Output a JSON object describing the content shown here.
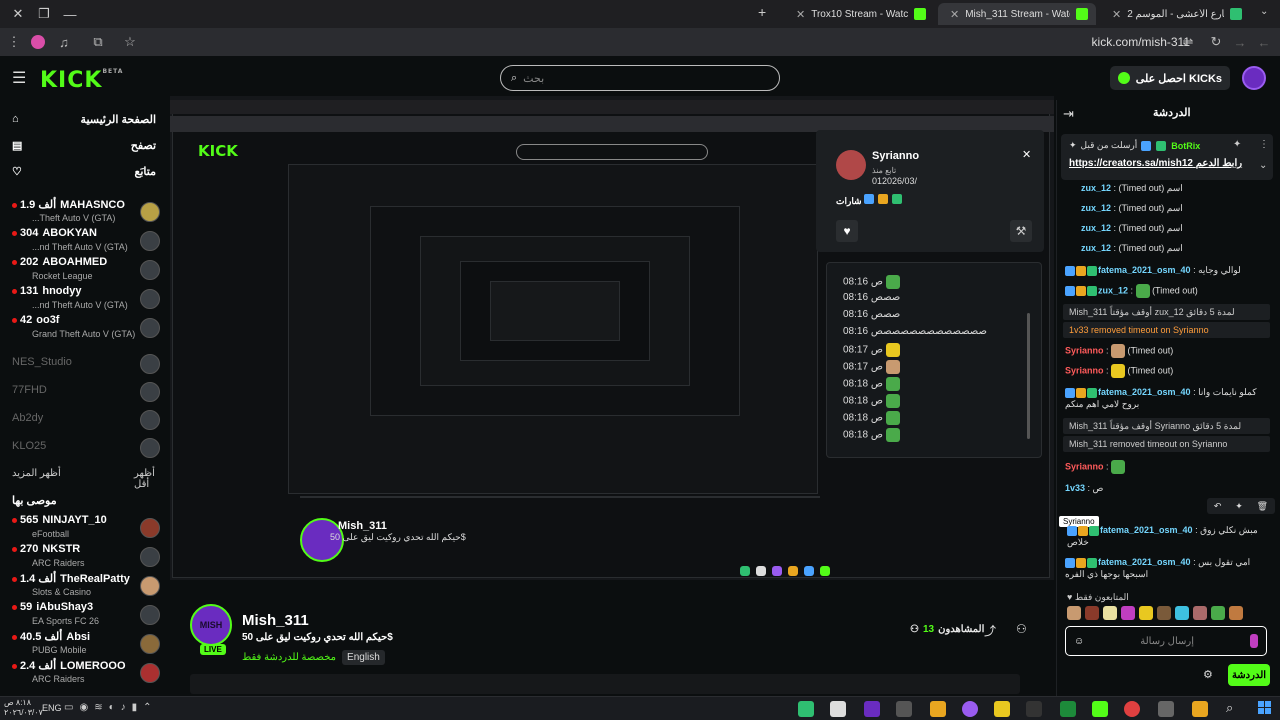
{
  "browser": {
    "tabs": [
      {
        "label": "Trox10 Stream - Watch Live on",
        "active": false
      },
      {
        "label": "Mish_311 Stream - Watch Live o",
        "active": true
      },
      {
        "label": "شاهد شارع الأعشى - الموسم 2 |",
        "active": false
      }
    ],
    "url": "kick.com/mish-311"
  },
  "header": {
    "logo": "KICK",
    "logo_sup": "BETA",
    "search_placeholder": "بحث",
    "get_kicks": "احصل على KICKs"
  },
  "sidebar": {
    "nav": [
      {
        "label": "الصفحة الرئيسية",
        "icon": "home-icon"
      },
      {
        "label": "تصفح",
        "icon": "browse-icon"
      },
      {
        "label": "متابَع",
        "icon": "heart-icon"
      }
    ],
    "following": [
      {
        "viewers": "1.9 ألف",
        "name": "MAHASNCO",
        "game": "...Theft Auto V (GTA)",
        "live": true
      },
      {
        "viewers": "304",
        "name": "ABOKYAN",
        "game": "...nd Theft Auto V (GTA)",
        "live": true
      },
      {
        "viewers": "202",
        "name": "ABOAHMED",
        "game": "Rocket League",
        "live": true
      },
      {
        "viewers": "131",
        "name": "hnodyy",
        "game": "...nd Theft Auto V (GTA)",
        "live": true
      },
      {
        "viewers": "42",
        "name": "oo3f",
        "game": "Grand Theft Auto V (GTA)",
        "live": true
      },
      {
        "viewers": "",
        "name": "NES_Studio",
        "game": "",
        "live": false
      },
      {
        "viewers": "",
        "name": "77FHD",
        "game": "",
        "live": false
      },
      {
        "viewers": "",
        "name": "Ab2dy",
        "game": "",
        "live": false
      },
      {
        "viewers": "",
        "name": "KLO25",
        "game": "",
        "live": false
      }
    ],
    "show_more_left": "أظهر المزيد",
    "show_more_right": "أظهر أقل",
    "recommended_title": "موصى بها",
    "recommended": [
      {
        "viewers": "565",
        "name": "NINJAYT_10",
        "game": "eFootball"
      },
      {
        "viewers": "270",
        "name": "NKSTR",
        "game": "ARC Raiders"
      },
      {
        "viewers": "1.4 ألف",
        "name": "TheRealPatty",
        "game": "Slots & Casino"
      },
      {
        "viewers": "59",
        "name": "iAbuShay3",
        "game": "EA Sports FC 26"
      },
      {
        "viewers": "40.5 ألف",
        "name": "Absi",
        "game": "PUBG Mobile"
      },
      {
        "viewers": "2.4 ألف",
        "name": "LOMEROOO",
        "game": "ARC Raiders"
      }
    ]
  },
  "profile_card": {
    "name": "Syrianno",
    "followed": "تابع منذ",
    "date": "012026/03/",
    "badges_label": "شارات"
  },
  "chat_popup": {
    "lines": [
      {
        "time": "08:16",
        "text": "ص"
      },
      {
        "time": "08:16",
        "text": "صصص"
      },
      {
        "time": "08:16",
        "text": "صصص"
      },
      {
        "time": "08:16",
        "text": "صصصصصصصصصصصصص"
      },
      {
        "time": "08:17",
        "text": "ص"
      },
      {
        "time": "08:17",
        "text": "ص"
      },
      {
        "time": "08:18",
        "text": "ص"
      },
      {
        "time": "08:18",
        "text": "ص"
      },
      {
        "time": "08:18",
        "text": "ص"
      },
      {
        "time": "08:18",
        "text": "ص"
      }
    ]
  },
  "channel": {
    "name": "Mish_311",
    "avatar_text": "MISH",
    "live": "LIVE",
    "title": "حيكم الله تحدي روكيت ليق على 50$",
    "tag_category": "مخصصة للدردشة فقط",
    "tag_lang": "English",
    "viewers": "13",
    "viewers_label": "المشاهدون"
  },
  "chat": {
    "title": "الدردشة",
    "pinned_user": "BotRix",
    "pinned_by": "أرسلت من قبل",
    "pinned_link": "https://creators.sa/mish12",
    "pinned_prefix": "رابط الدعم",
    "messages": [
      {
        "user": "zux_12",
        "text": "(Timed out) اسم",
        "type": "g"
      },
      {
        "user": "zux_12",
        "text": "(Timed out) اسم",
        "type": "g"
      },
      {
        "user": "zux_12",
        "text": "(Timed out) اسم",
        "type": "g"
      },
      {
        "user": "zux_12",
        "text": "(Timed out) اسم",
        "type": "g"
      },
      {
        "user": "fatema_2021_osm_40",
        "text": "لوالي وجايه",
        "type": "g"
      },
      {
        "user": "zux_12",
        "text": "(Timed out)",
        "type": "g"
      }
    ],
    "sys1": "Mish_311 أوقف مؤقتاً zux_12 لمدة 5 دقائق",
    "sys2": "1v33 removed timeout on Syrianno",
    "msg_s1_user": "Syrianno",
    "msg_s1_text": "(Timed out)",
    "msg_s2_user": "Syrianno",
    "msg_s2_text": "(Timed out)",
    "msg_f1_user": "fatema_2021_osm_40",
    "msg_f1_text": "كملو نايمات وانا بروح لامي اهم منكم",
    "sys3": "Mish_311 أوقف مؤقتاً Syrianno لمدة 5 دقائق",
    "sys4": "Mish_311 removed timeout on Syrianno",
    "msg_s3_user": "Syrianno",
    "msg_v_user": "1v33",
    "msg_v_text": "ص",
    "tooltip": "Syrianno",
    "msg_f2_user": "fatema_2021_osm_40",
    "msg_f2_text": "مبش نكلي زوق",
    "msg_f2_line2": "خلاص",
    "msg_f3_user": "fatema_2021_osm_40",
    "msg_f3_text": "امي تقول بس",
    "msg_f3_line2": "اسبحها بوجها ذي الفره",
    "followers_only": "المتابعون فقط",
    "input_placeholder": "إرسال رسالة",
    "send": "الدردشة"
  },
  "taskbar": {
    "lang": "ENG",
    "time": "٨:١٨ ص",
    "date": "٢٠٢٦/٠٣/٠٧"
  },
  "colors": {
    "kick_green": "#53fc18",
    "user_blue": "#75d7ff",
    "user_red": "#ff5b5b",
    "purple": "#6a2cc0"
  }
}
